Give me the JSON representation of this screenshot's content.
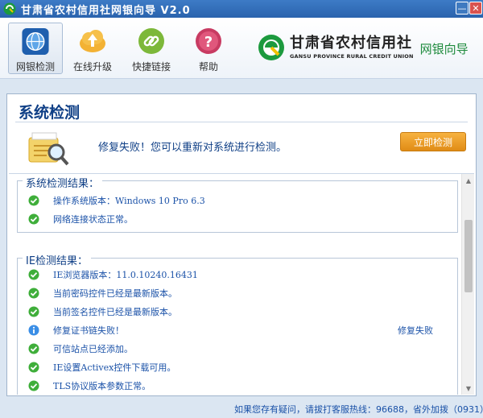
{
  "window": {
    "title": "甘肃省农村信用社网银向导 V2.0",
    "minimize_glyph": "—",
    "close_glyph": "✕"
  },
  "toolbar": {
    "items": [
      {
        "label": "网银检测",
        "icon": "globe-icon",
        "active": true
      },
      {
        "label": "在线升级",
        "icon": "upload-cloud-icon",
        "active": false
      },
      {
        "label": "快捷链接",
        "icon": "link-icon",
        "active": false
      },
      {
        "label": "帮助",
        "icon": "help-icon",
        "active": false
      }
    ]
  },
  "brand": {
    "name_cn": "甘肃省农村信用社",
    "name_en": "GANSU PROVINCE RURAL CREDIT UNION",
    "subtitle": "网银向导"
  },
  "main": {
    "title": "系统检测",
    "message": "修复失败！您可以重新对系统进行检测。",
    "action_button": "立即检测"
  },
  "system_results": {
    "title": "系统检测结果：",
    "items": [
      {
        "text": "操作系统版本：Windows 10 Pro 6.3",
        "status": "ok"
      },
      {
        "text": "网络连接状态正常。",
        "status": "ok"
      }
    ]
  },
  "ie_results": {
    "title": "IE检测结果：",
    "items": [
      {
        "text": "IE浏览器版本：11.0.10240.16431",
        "status": "ok",
        "result": ""
      },
      {
        "text": "当前密码控件已经是最新版本。",
        "status": "ok",
        "result": ""
      },
      {
        "text": "当前签名控件已经是最新版本。",
        "status": "ok",
        "result": ""
      },
      {
        "text": "修复证书链失败！",
        "status": "info",
        "result": "修复失败"
      },
      {
        "text": "可信站点已经添加。",
        "status": "ok",
        "result": ""
      },
      {
        "text": "IE设置Activex控件下载可用。",
        "status": "ok",
        "result": ""
      },
      {
        "text": "TLS协议版本参数正常。",
        "status": "ok",
        "result": ""
      }
    ]
  },
  "footer": {
    "text": "如果您存有疑问，请拔打客服热线：96688，省外加拨（0931）。"
  },
  "colors": {
    "accent": "#0f3f86",
    "ok": "#3fae3a",
    "info": "#3a8ee6",
    "button": "#f0a02c"
  }
}
